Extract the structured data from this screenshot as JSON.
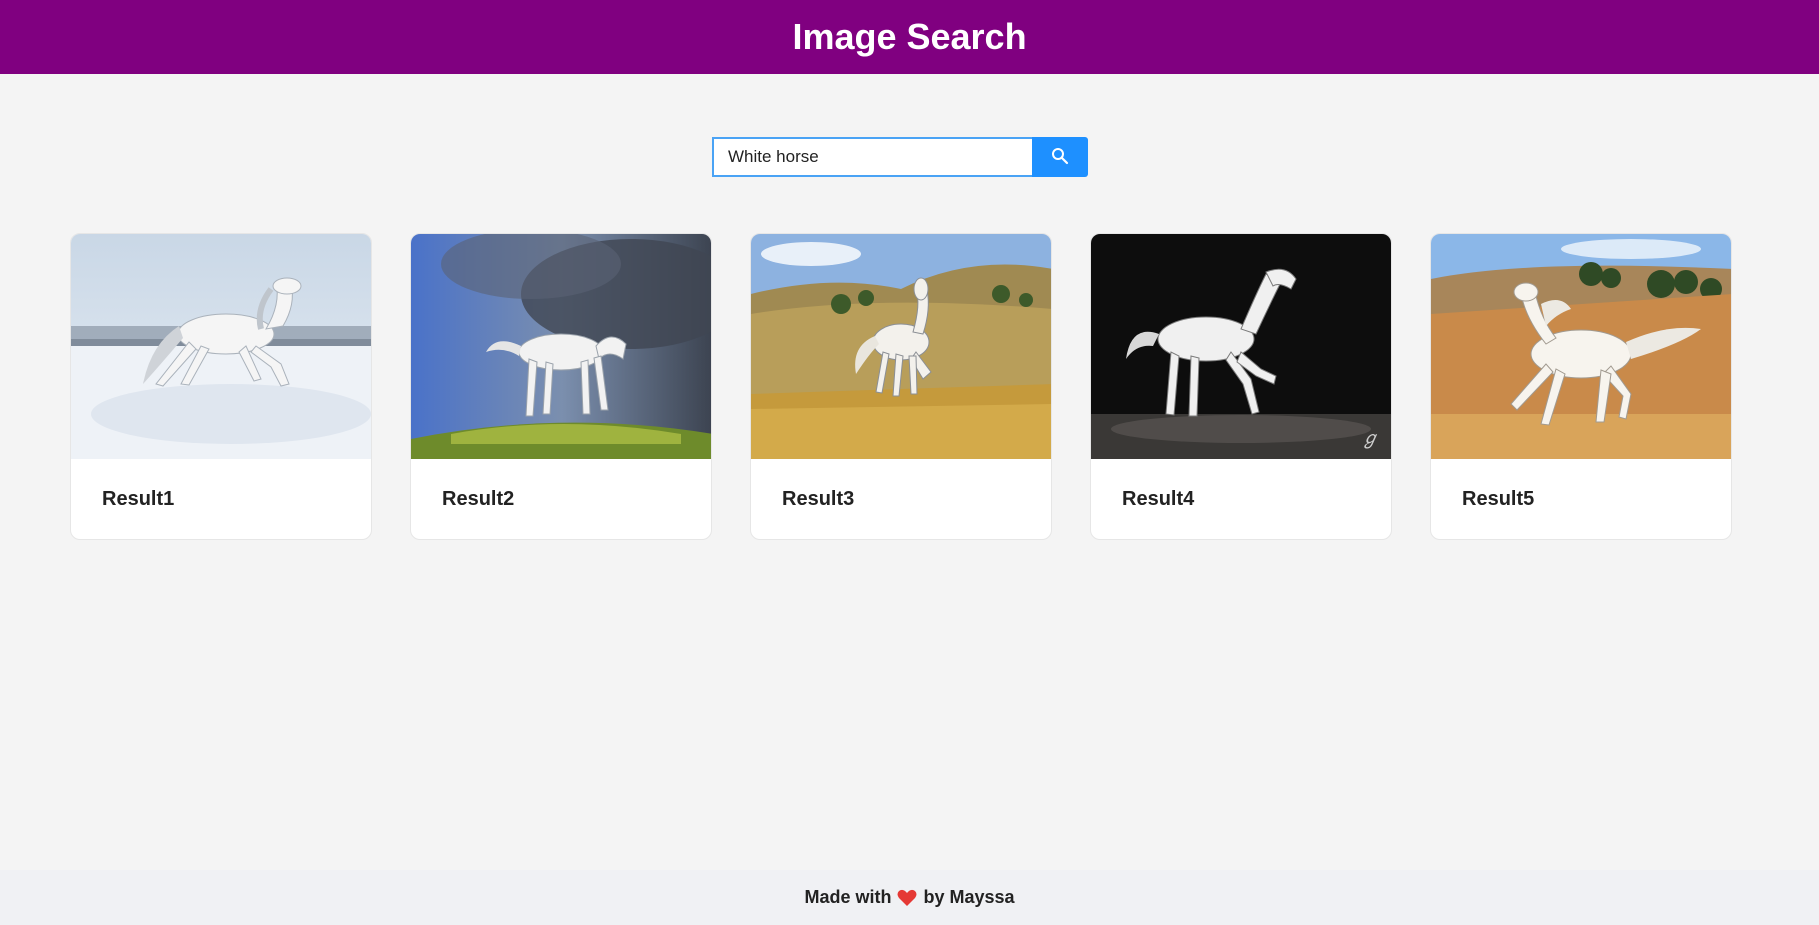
{
  "header": {
    "title": "Image Search"
  },
  "search": {
    "value": "White horse",
    "icon": "search-icon",
    "button_color": "#1e90ff"
  },
  "results": [
    {
      "title": "Result1",
      "image": "white horse galloping in snow"
    },
    {
      "title": "Result2",
      "image": "white horse on hill under storm clouds"
    },
    {
      "title": "Result3",
      "image": "white horse trotting in golden field"
    },
    {
      "title": "Result4",
      "image": "white arabian horse on dark background"
    },
    {
      "title": "Result5",
      "image": "white horse running in desert"
    }
  ],
  "footer": {
    "prefix": "Made with",
    "icon": "heart-icon",
    "suffix": "by Mayssa"
  },
  "colors": {
    "header": "#800080",
    "background": "#f4f4f4",
    "accent": "#1e90ff"
  }
}
